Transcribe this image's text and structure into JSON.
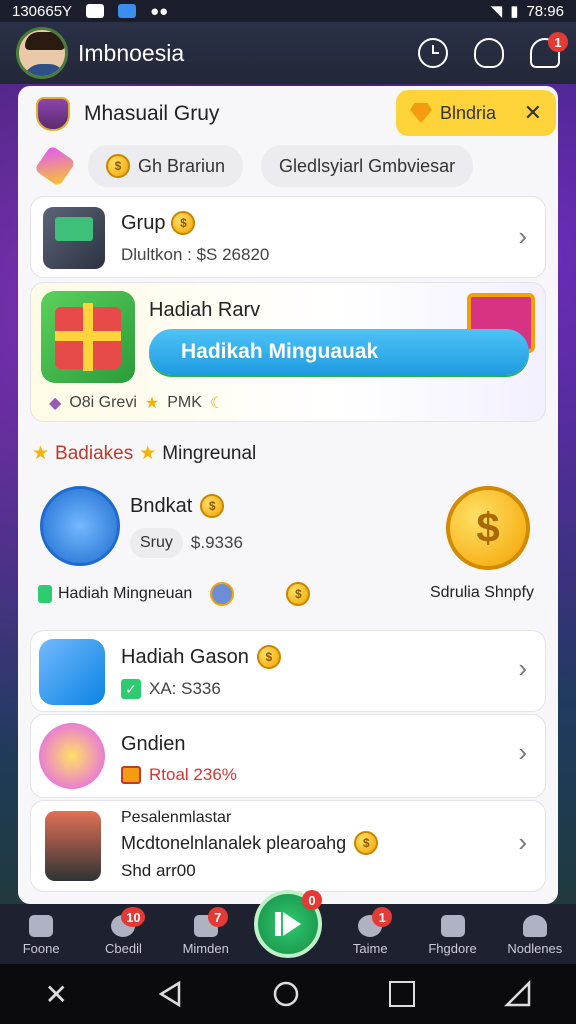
{
  "status_bar": {
    "left_text": "130665Y",
    "right_text": "78:96"
  },
  "header": {
    "title": "Imbnoesia",
    "icons": [
      "clock-icon",
      "user-icon",
      "bell-icon"
    ],
    "bell_badge": "1"
  },
  "top": {
    "profile_name": "Mhasuail Gruy",
    "yellow_pill_label": "Blndria",
    "close_label": "✕",
    "chip1": "Gh Brariun",
    "chip2": "Gledlsyiarl Gmbviesar"
  },
  "group_card": {
    "title": "Grup",
    "subtitle": "Dlultkon : $S 26820"
  },
  "reward_banner": {
    "title": "Hadiah Rarv",
    "button": "Hadikah Minguauak",
    "footer1": "O8i Grevi",
    "footer2": "PMK"
  },
  "section": {
    "title1": "Badiakes",
    "title2": "Mingreunal"
  },
  "feature": {
    "name": "Bndkat",
    "chip": "Sruy",
    "value": "$.9336",
    "footer_left": "Hadiah Mingneuan",
    "footer_right": "Sdrulia Shnpfy"
  },
  "list": [
    {
      "title": "Hadiah Gason",
      "sub": "XA: S336",
      "sub_color": "#555"
    },
    {
      "title": "Gndien",
      "sub": "Rtoal 236%",
      "sub_color": "#e03131"
    },
    {
      "title": "Pesalenmlastar",
      "line2": "Mcdtonelnlanalek plearoahg",
      "line3": "Shd arr00"
    }
  ],
  "bottom_nav": [
    {
      "label": "Foone",
      "badge": ""
    },
    {
      "label": "Cbedil",
      "badge": "10"
    },
    {
      "label": "Mimden",
      "badge": "7"
    },
    {
      "label": "",
      "badge": "0"
    },
    {
      "label": "Taime",
      "badge": "1"
    },
    {
      "label": "Fhgdore",
      "badge": ""
    },
    {
      "label": "Nodlenes",
      "badge": ""
    }
  ],
  "colors": {
    "accent_blue": "#1e9be0",
    "yellow": "#ffd43b",
    "green": "#2ecc71",
    "badge_red": "#e53935"
  }
}
